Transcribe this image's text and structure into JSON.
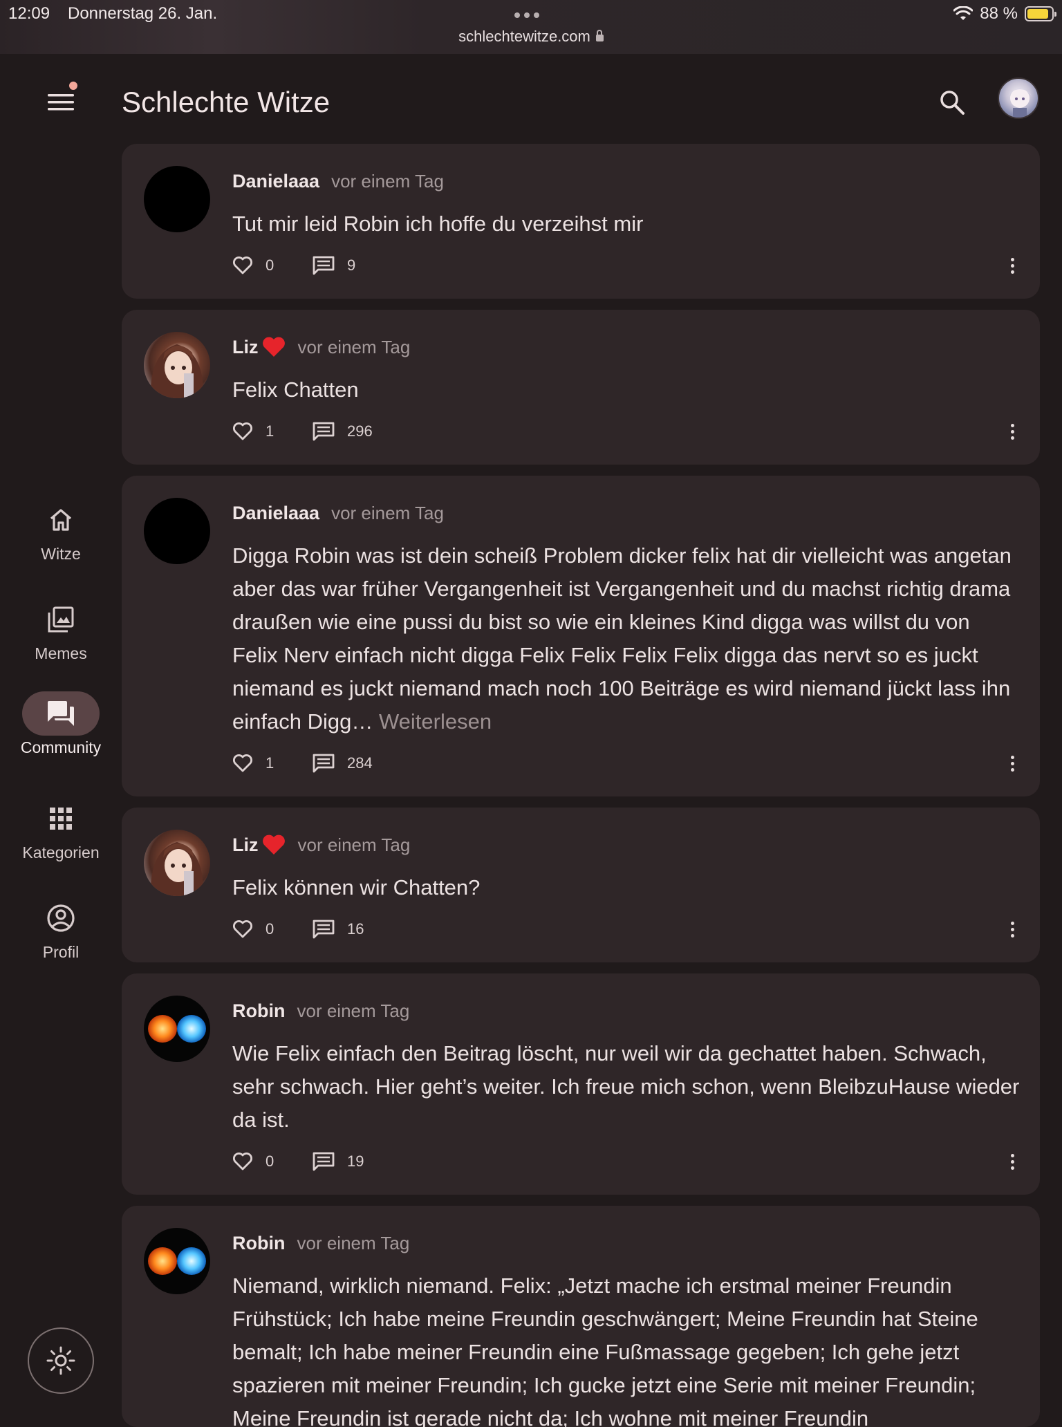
{
  "status": {
    "time": "12:09",
    "date": "Donnerstag 26. Jan.",
    "url": "schlechtewitze.com",
    "battery": "88 %",
    "battery_level": 0.88
  },
  "header": {
    "title": "Schlechte Witze"
  },
  "nav": {
    "items": [
      {
        "label": "Witze",
        "icon": "home-icon",
        "active": false
      },
      {
        "label": "Memes",
        "icon": "image-gallery-icon",
        "active": false
      },
      {
        "label": "Community",
        "icon": "forum-icon",
        "active": true
      },
      {
        "label": "Kategorien",
        "icon": "grid-icon",
        "active": false
      },
      {
        "label": "Profil",
        "icon": "account-circle-icon",
        "active": false
      }
    ]
  },
  "posts": [
    {
      "author": "Danielaaa",
      "time": "vor einem Tag",
      "text": "Tut mir leid Robin ich hoffe du verzeihst mir",
      "likes": "0",
      "comments": "9",
      "avatar": "black"
    },
    {
      "author": "Liz",
      "badge": "heart",
      "time": "vor einem Tag",
      "text": "Felix Chatten",
      "likes": "1",
      "comments": "296",
      "avatar": "anime-girl"
    },
    {
      "author": "Danielaaa",
      "time": "vor einem Tag",
      "text": "Digga Robin was ist dein scheiß Problem dicker felix hat dir vielleicht was angetan aber das war früher Vergangenheit ist Vergangenheit und du machst richtig drama draußen wie eine pussi du bist so wie ein kleines Kind digga was willst du von Felix Nerv einfach nicht digga Felix Felix Felix Felix digga das nervt so es juckt niemand es juckt niemand mach noch 100 Beiträge es wird niemand jückt lass ihn einfach Digg…",
      "readmore": "Weiterlesen",
      "likes": "1",
      "comments": "284",
      "avatar": "black"
    },
    {
      "author": "Liz",
      "badge": "heart",
      "time": "vor einem Tag",
      "text": "Felix können wir Chatten?",
      "likes": "0",
      "comments": "16",
      "avatar": "anime-girl"
    },
    {
      "author": "Robin",
      "time": "vor einem Tag",
      "text": "Wie Felix einfach den Beitrag löscht, nur weil wir da gechattet haben. Schwach, sehr schwach. Hier geht’s weiter. Ich freue mich schon, wenn BleibzuHause wieder da ist.",
      "likes": "0",
      "comments": "19",
      "avatar": "fire-ice-fists"
    },
    {
      "author": "Robin",
      "time": "vor einem Tag",
      "text": "Niemand, wirklich niemand. Felix: „Jetzt mache ich erstmal meiner Freundin Frühstück; Ich habe meine Freundin geschwängert; Meine Freundin hat Steine bemalt; Ich habe meiner Freundin eine Fußmassage gegeben; Ich gehe jetzt spazieren mit meiner Freundin; Ich gucke jetzt eine Serie mit meiner Freundin; Meine Freundin ist gerade nicht da; Ich wohne mit meiner Freundin",
      "avatar": "fire-ice-fists"
    }
  ],
  "colors": {
    "background": "#201a1b",
    "card": "#2f2628",
    "nav_active": "#5a4446",
    "accent_dot": "#f4a89a"
  }
}
